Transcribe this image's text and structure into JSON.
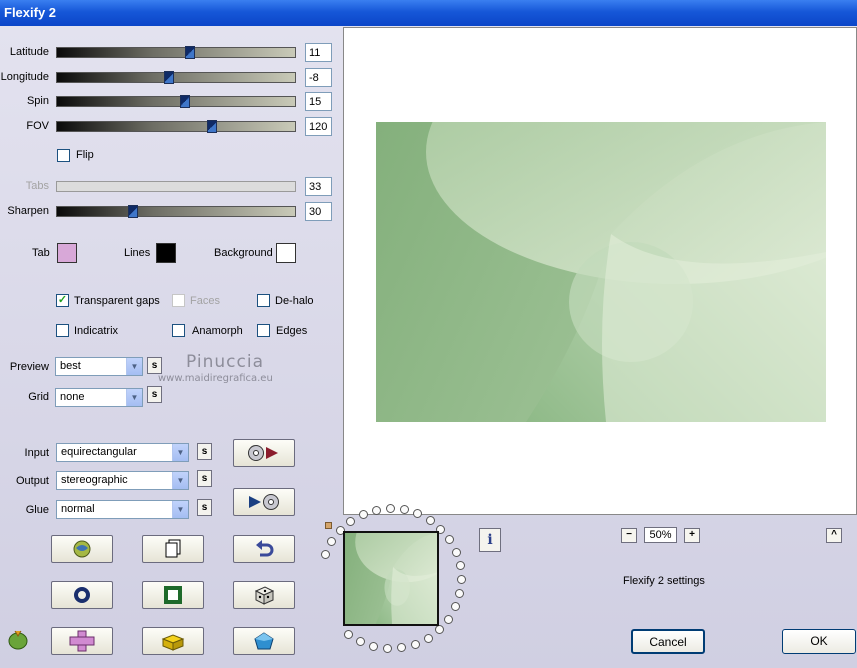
{
  "window": {
    "title": "Flexify 2"
  },
  "sliders": [
    {
      "id": "latitude",
      "label": "Latitude",
      "value": "11",
      "position": 0.56,
      "enabled": true
    },
    {
      "id": "longitude",
      "label": "Longitude",
      "value": "-8",
      "position": 0.47,
      "enabled": true
    },
    {
      "id": "spin",
      "label": "Spin",
      "value": "15",
      "position": 0.54,
      "enabled": true
    },
    {
      "id": "fov",
      "label": "FOV",
      "value": "120",
      "position": 0.66,
      "enabled": true
    },
    {
      "id": "tabs",
      "label": "Tabs",
      "value": "33",
      "position": 0.0,
      "enabled": false
    },
    {
      "id": "sharpen",
      "label": "Sharpen",
      "value": "30",
      "position": 0.31,
      "enabled": true
    }
  ],
  "flip": {
    "label": "Flip",
    "checked": false
  },
  "colors": {
    "tab": {
      "label": "Tab",
      "color": "#d8a8d8"
    },
    "lines": {
      "label": "Lines",
      "color": "#000000"
    },
    "background": {
      "label": "Background",
      "color": "#ffffff"
    }
  },
  "options": {
    "transparent_gaps": {
      "label": "Transparent gaps",
      "checked": true
    },
    "faces": {
      "label": "Faces",
      "checked": false,
      "enabled": false
    },
    "de_halo": {
      "label": "De-halo",
      "checked": false
    },
    "indicatrix": {
      "label": "Indicatrix",
      "checked": false
    },
    "anamorph": {
      "label": "Anamorph",
      "checked": false
    },
    "edges": {
      "label": "Edges",
      "checked": false
    }
  },
  "preview": {
    "label": "Preview",
    "value": "best"
  },
  "grid": {
    "label": "Grid",
    "value": "none"
  },
  "input": {
    "label": "Input",
    "value": "equirectangular"
  },
  "output": {
    "label": "Output",
    "value": "stereographic"
  },
  "glue": {
    "label": "Glue",
    "value": "normal"
  },
  "s_button": "s",
  "watermark": {
    "name": "Pinuccia",
    "site": "www.maidiregrafica.eu"
  },
  "zoom": {
    "value": "50%",
    "minus": "−",
    "plus": "+"
  },
  "up_button": "^",
  "info_button": "i",
  "settings_label": "Flexify 2 settings",
  "buttons": {
    "cancel": "Cancel",
    "ok": "OK"
  },
  "preview_colors": {
    "dark": "#84b07c",
    "mid": "#a5c79b",
    "light": "#e4eedb"
  }
}
